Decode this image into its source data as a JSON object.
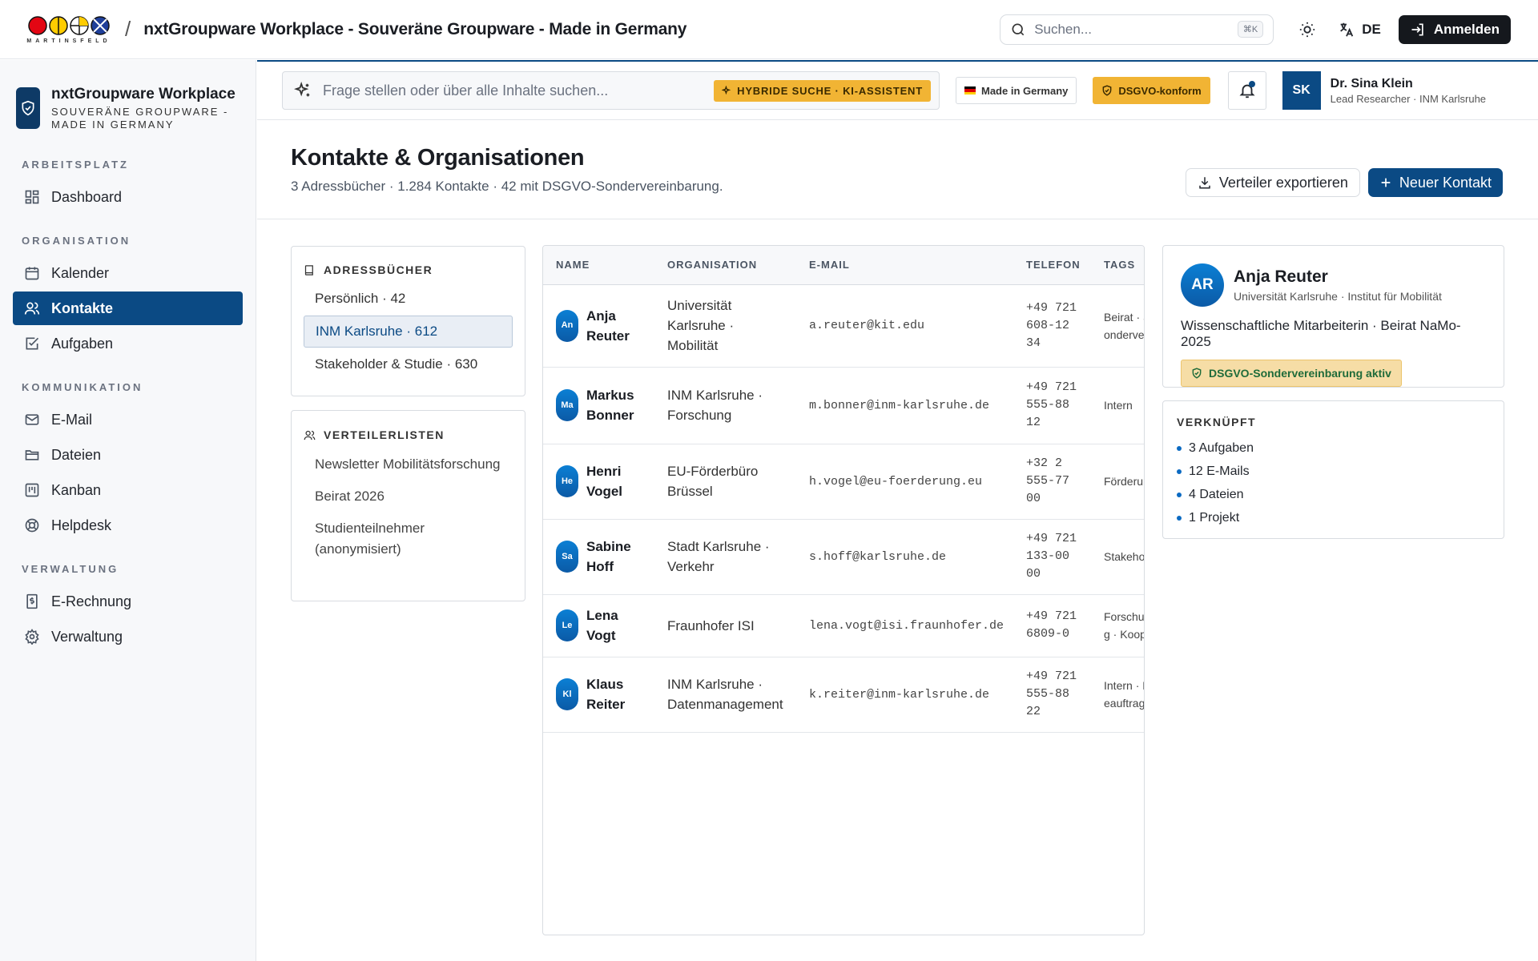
{
  "app": {
    "logo_text": "MARTINSFELD",
    "separator": "/",
    "title": "nxtGroupware Workplace - Souveräne Groupware - Made in Germany"
  },
  "topbar": {
    "search_placeholder": "Suchen...",
    "search_shortcut": "⌘K",
    "theme_icon": "sun-icon",
    "language": "DE",
    "login_label": "Anmelden"
  },
  "sidebar": {
    "brand_name": "nxtGroupware Workplace",
    "brand_sub": "SOUVERÄNE GROUPWARE - MADE IN GERMANY",
    "sections": [
      {
        "title": "ARBEITSPLATZ",
        "items": [
          {
            "label": "Dashboard",
            "icon": "dashboard-icon"
          }
        ]
      },
      {
        "title": "ORGANISATION",
        "items": [
          {
            "label": "Kalender",
            "icon": "calendar-icon"
          },
          {
            "label": "Kontakte",
            "icon": "contacts-icon",
            "active": true
          },
          {
            "label": "Aufgaben",
            "icon": "tasks-icon"
          }
        ]
      },
      {
        "title": "KOMMUNIKATION",
        "items": [
          {
            "label": "E-Mail",
            "icon": "mail-icon"
          },
          {
            "label": "Dateien",
            "icon": "folder-icon"
          },
          {
            "label": "Kanban",
            "icon": "kanban-icon"
          },
          {
            "label": "Helpdesk",
            "icon": "helpdesk-icon"
          }
        ]
      },
      {
        "title": "VERWALTUNG",
        "items": [
          {
            "label": "E-Rechnung",
            "icon": "invoice-icon"
          },
          {
            "label": "Verwaltung",
            "icon": "settings-icon"
          }
        ]
      }
    ]
  },
  "subbar": {
    "ai_placeholder": "Frage stellen oder über alle Inhalte suchen...",
    "ai_badge": "HYBRIDE SUCHE · KI-ASSISTENT",
    "made_in_germany": "Made in Germany",
    "gdpr": "DSGVO-konform",
    "user_initials": "SK",
    "user_name": "Dr. Sina Klein",
    "user_role": "Lead Researcher · INM Karlsruhe"
  },
  "page": {
    "title": "Kontakte & Organisationen",
    "subtitle": "3 Adressbücher · 1.284 Kontakte · 42 mit DSGVO-Sondervereinbarung.",
    "export_label": "Verteiler exportieren",
    "new_label": "Neuer Kontakt"
  },
  "address_books": {
    "title": "ADRESSBÜCHER",
    "items": [
      "Persönlich · 42",
      "INM Karlsruhe · 612",
      "Stakeholder & Studie · 630"
    ],
    "active_index": 1
  },
  "distribution_lists": {
    "title": "VERTEILERLISTEN",
    "items": [
      "Newsletter Mobilitätsforschung",
      "Beirat 2026",
      "Studienteilnehmer (anonymisiert)"
    ]
  },
  "table": {
    "columns": [
      "NAME",
      "ORGANISATION",
      "E-MAIL",
      "TELEFON",
      "TAGS"
    ],
    "rows": [
      {
        "initials": "An",
        "first": "Anja",
        "last": "Reuter",
        "org": "Universität Karlsruhe · Mobilität",
        "email": "a.reuter@kit.edu",
        "phone": "+49 721 608-12 34",
        "tags": "Beirat · Sondervereinbarung"
      },
      {
        "initials": "Ma",
        "first": "Markus",
        "last": "Bonner",
        "org": "INM Karlsruhe · Forschung",
        "email": "m.bonner@inm-karlsruhe.de",
        "phone": "+49 721 555-88 12",
        "tags": "Intern"
      },
      {
        "initials": "He",
        "first": "Henri",
        "last": "Vogel",
        "org": "EU-Förderbüro Brüssel",
        "email": "h.vogel@eu-foerderung.eu",
        "phone": "+32 2 555-77 00",
        "tags": "Förderung"
      },
      {
        "initials": "Sa",
        "first": "Sabine",
        "last": "Hoff",
        "org": "Stadt Karlsruhe · Verkehr",
        "email": "s.hoff@karlsruhe.de",
        "phone": "+49 721 133-00 00",
        "tags": "Stakeholder"
      },
      {
        "initials": "Le",
        "first": "Lena",
        "last": "Vogt",
        "org": "Fraunhofer ISI",
        "email": "lena.vogt@isi.fraunhofer.de",
        "phone": "+49 721 6809-0",
        "tags": "Forschung · Kooperation"
      },
      {
        "initials": "Kl",
        "first": "Klaus",
        "last": "Reiter",
        "org": "INM Karlsruhe · Datenmanagement",
        "email": "k.reiter@inm-karlsruhe.de",
        "phone": "+49 721 555-88 22",
        "tags": "Intern · Beauftragter"
      }
    ]
  },
  "detail": {
    "initials": "AR",
    "name": "Anja Reuter",
    "org": "Universität Karlsruhe · Institut für Mobilität",
    "role": "Wissenschaftliche Mitarbeiterin · Beirat NaMo-2025",
    "badge": "DSGVO-Sondervereinbarung aktiv"
  },
  "linked": {
    "title": "VERKNÜPFT",
    "items": [
      "3 Aufgaben",
      "12 E-Mails",
      "4 Dateien",
      "1 Projekt"
    ]
  },
  "colors": {
    "primary": "#0b4a84",
    "accent": "#f1b434",
    "dark": "#15181d"
  }
}
